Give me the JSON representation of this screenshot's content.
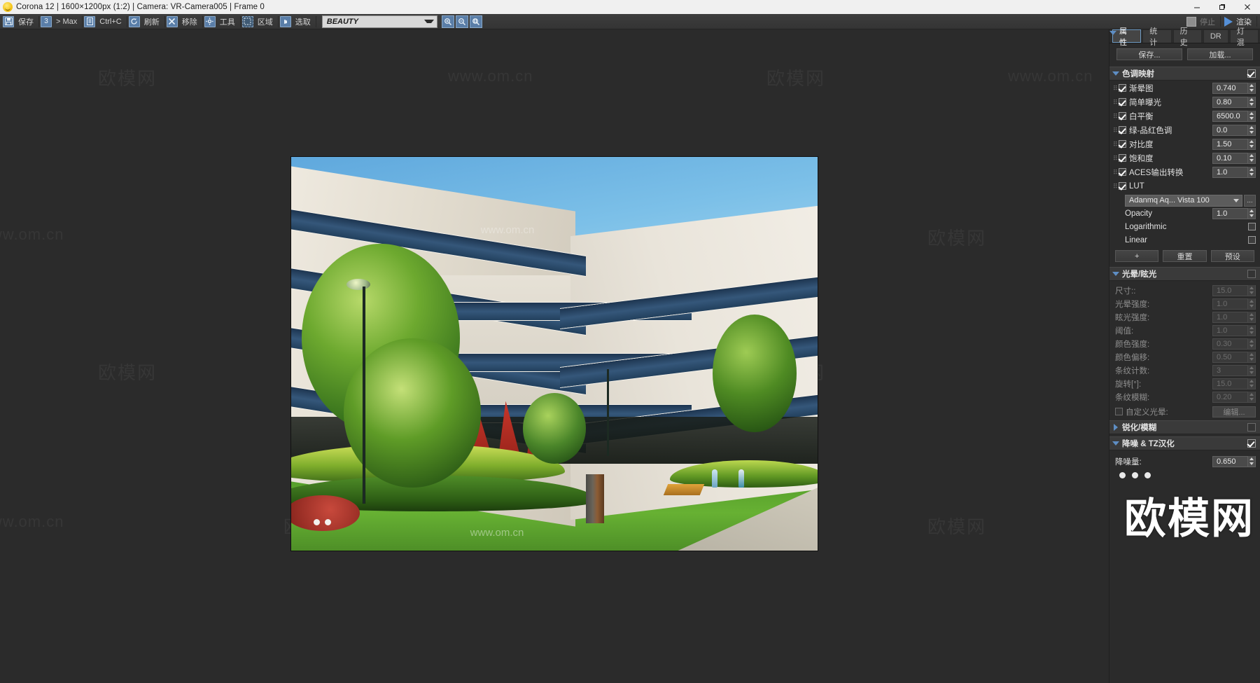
{
  "titlebar": {
    "icon": "corona-smiley-icon",
    "title": "Corona 12 | 1600×1200px (1:2) | Camera: VR-Camera005 | Frame 0",
    "minimize": "minimize-icon",
    "maximize": "maximize-icon",
    "close": "close-icon"
  },
  "toolbar": {
    "buttons": [
      {
        "label": "保存",
        "icon": "save-icon"
      },
      {
        "label": "> Max",
        "icon": "max-icon"
      },
      {
        "label": "Ctrl+C",
        "icon": "copy-icon"
      },
      {
        "label": "刷新",
        "icon": "refresh-icon"
      },
      {
        "label": "移除",
        "icon": "remove-icon"
      },
      {
        "label": "工具",
        "icon": "gear-icon"
      },
      {
        "label": "区域",
        "icon": "region-icon"
      },
      {
        "label": "选取",
        "icon": "pick-icon"
      }
    ],
    "pass_select": "BEAUTY",
    "zoom_buttons": [
      {
        "icon": "zoom-in-icon"
      },
      {
        "icon": "zoom-out-icon"
      },
      {
        "icon": "zoom-fit-icon"
      }
    ],
    "stop_label": "停止",
    "render_label": "渲染"
  },
  "panel": {
    "tabs": [
      {
        "label": "属性",
        "active": true
      },
      {
        "label": "统计",
        "active": false
      },
      {
        "label": "历史",
        "active": false
      },
      {
        "label": "DR",
        "active": false
      },
      {
        "label": "灯混",
        "active": false
      }
    ],
    "save_label": "保存...",
    "load_label": "加载...",
    "tonemap": {
      "title": "色调映射",
      "enabled": true,
      "rows": [
        {
          "label": "渐晕图",
          "value": "0.740",
          "checked": true
        },
        {
          "label": "简单曝光",
          "value": "0.80",
          "checked": true
        },
        {
          "label": "白平衡",
          "value": "6500.0",
          "checked": true
        },
        {
          "label": "绿-品红色调",
          "value": "0.0",
          "checked": true
        },
        {
          "label": "对比度",
          "value": "1.50",
          "checked": true
        },
        {
          "label": "饱和度",
          "value": "0.10",
          "checked": true
        },
        {
          "label": "ACES输出转换",
          "value": "1.0",
          "checked": true
        },
        {
          "label": "LUT",
          "value": "",
          "checked": true
        }
      ],
      "lut_name": "Adanmq Aq... Vista 100",
      "lut_browse": "...",
      "opacity_label": "Opacity",
      "opacity_value": "1.0",
      "logarithmic_label": "Logarithmic",
      "linear_label": "Linear",
      "add_label": "+",
      "reset_label": "重置",
      "preset_label": "预设"
    },
    "bloom": {
      "title": "光晕/眩光",
      "enabled": false,
      "rows": [
        {
          "label": "尺寸::",
          "value": "15.0"
        },
        {
          "label": "光晕强度:",
          "value": "1.0"
        },
        {
          "label": "眩光强度:",
          "value": "1.0"
        },
        {
          "label": "阈值:",
          "value": "1.0"
        },
        {
          "label": "颜色强度:",
          "value": "0.30"
        },
        {
          "label": "颜色偏移:",
          "value": "0.50"
        },
        {
          "label": "条纹计数:",
          "value": "3"
        },
        {
          "label": "旋转[°]:",
          "value": "15.0"
        },
        {
          "label": "条纹模糊:",
          "value": "0.20"
        }
      ],
      "custom_label": "自定义光晕:",
      "edit_label": "编辑..."
    },
    "sharpen": {
      "title": "锐化/模糊",
      "enabled": false
    },
    "denoise": {
      "title": "降噪 & TZ汉化",
      "enabled": true,
      "amount_label": "降噪量:",
      "amount_value": "0.650"
    }
  },
  "watermark": {
    "cn": "欧模网",
    "url": "www.om.cn",
    "big": "欧模网"
  },
  "colors": {
    "accent": "#5a7ea8",
    "tab_active_border": "#6f9bc4",
    "panel_bg": "#2b2b2b",
    "titlebar_bg": "#f0f0f0"
  }
}
